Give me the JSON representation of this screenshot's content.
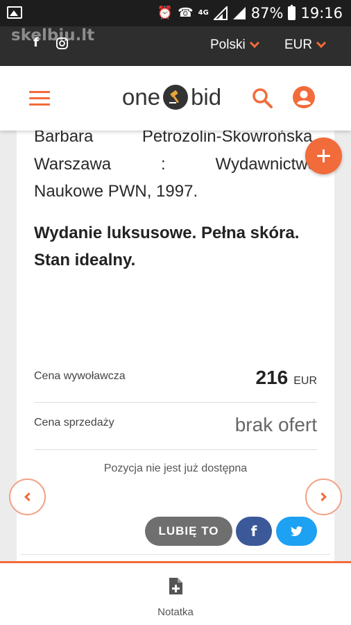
{
  "status_bar": {
    "network": "4G",
    "battery": "87%",
    "time": "19:16"
  },
  "top_bar": {
    "watermark": "skelbiu.lt",
    "language": "Polski",
    "currency": "EUR"
  },
  "header": {
    "logo_left": "one",
    "logo_right": "bid"
  },
  "description": {
    "line1": "Barbara Petrozolin-Skowrońska,",
    "line2_words": [
      "Warszawa",
      ":",
      "Wydawnictwo"
    ],
    "line3": "Naukowe PWN, 1997.",
    "note": "Wydanie luksusowe. Pełna skóra. Stan idealny."
  },
  "pricing": {
    "starting_label": "Cena wywoławcza",
    "starting_value": "216",
    "starting_unit": "EUR",
    "sale_label": "Cena sprzedaży",
    "sale_value": "brak ofert",
    "availability": "Pozycja nie jest już dostępna"
  },
  "share": {
    "like_label": "LUBIĘ TO",
    "facebook_glyph": "f"
  },
  "bottom_bar": {
    "note_label": "Notatka"
  },
  "colors": {
    "accent": "#f26b3a",
    "topbar": "#2e2e2e",
    "like_button": "#6f6f6f",
    "facebook": "#3b5998",
    "twitter": "#1da1f2"
  }
}
